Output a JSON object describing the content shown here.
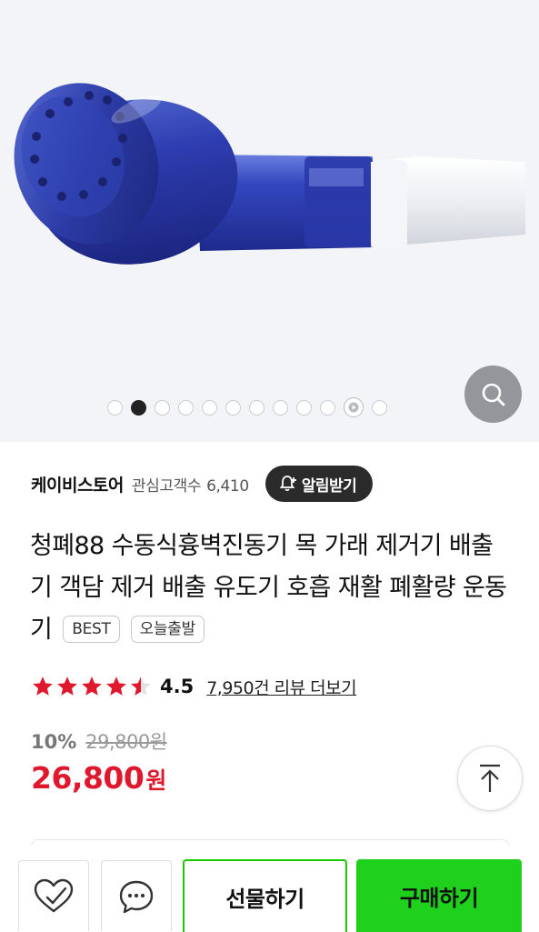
{
  "gallery": {
    "product_image": "blue-handheld-breathing-device",
    "page_count": 12,
    "active_index": 1,
    "video_index": 10,
    "zoom_icon": "search-icon"
  },
  "store": {
    "name": "케이비스토어",
    "watchers_label": "관심고객수",
    "watchers_count": "6,410",
    "alarm_label": "알림받기",
    "alarm_icon": "bell-plus-icon"
  },
  "product": {
    "title": "청폐88 수동식흉벽진동기 목 가래 제거기 배출기 객담 제거 배출 유도기 호흡 재활 폐활량 운동기",
    "tags": [
      "BEST",
      "오늘출발"
    ]
  },
  "rating": {
    "score": "4.5",
    "score_value": 4.5,
    "review_link": "7,950건 리뷰 더보기",
    "star_color": "#e0182d"
  },
  "price": {
    "discount_rate": "10%",
    "original": "29,800원",
    "sale": "26,800",
    "sale_unit": "원",
    "sale_color": "#e0182d"
  },
  "actions": {
    "wishlist_icon": "heart-check-icon",
    "talk_icon": "chat-bubble-icon",
    "gift_label": "선물하기",
    "buy_label": "구매하기",
    "buy_color": "#1fd01c",
    "scroll_top_icon": "arrow-up-icon"
  }
}
